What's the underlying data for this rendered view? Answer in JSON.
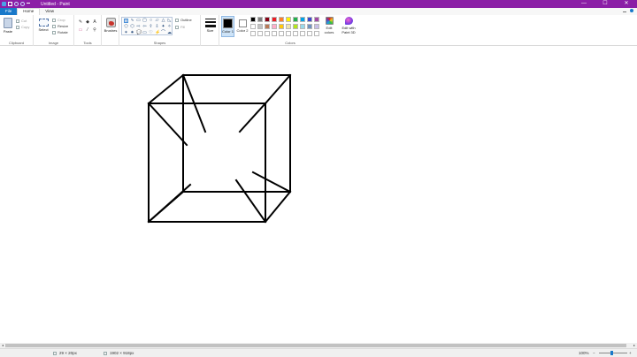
{
  "window": {
    "title": "Untitled - Paint",
    "minimize": "—",
    "maximize": "☐",
    "close": "✕"
  },
  "tabs": {
    "file": "File",
    "home": "Home",
    "view": "View"
  },
  "ribbon": {
    "clipboard": {
      "label": "Clipboard",
      "paste": "Paste",
      "cut": "Cut",
      "copy": "Copy"
    },
    "image": {
      "label": "Image",
      "select": "Select",
      "crop": "Crop",
      "resize": "Resize",
      "rotate": "Rotate"
    },
    "tools": {
      "label": "Tools",
      "pencil": "✎",
      "fill": "◆",
      "text": "A",
      "eraser": "▭",
      "picker": "⁄",
      "magnifier": "⚲"
    },
    "brushes": {
      "label": "Brushes"
    },
    "shapes": {
      "label": "Shapes",
      "outline": "Outline",
      "fill": "Fill",
      "items": [
        "\\",
        "∿",
        "▭",
        "▢",
        "○",
        "▱",
        "△",
        "◺",
        "⬠",
        "⬡",
        "⇨",
        "⇦",
        "⇧",
        "⇩",
        "✦",
        "✧",
        "✶",
        "✷",
        "💬",
        "▭",
        "♡",
        "⚡",
        "⌒",
        "☁"
      ]
    },
    "size": {
      "label": "Size"
    },
    "colors": {
      "label": "Colors",
      "color1": "Color 1",
      "color2": "Color 2",
      "color1_value": "#000000",
      "color2_value": "#ffffff",
      "edit_colors": "Edit colors",
      "edit_paint3d": "Edit with Paint 3D",
      "palette": [
        "#000000",
        "#7f7f7f",
        "#880015",
        "#ed1c24",
        "#ff7f27",
        "#fff200",
        "#22b14c",
        "#00a2e8",
        "#3f48cc",
        "#a349a4",
        "#ffffff",
        "#c3c3c3",
        "#b97a57",
        "#ffaec9",
        "#ffc90e",
        "#efe4b0",
        "#b5e61d",
        "#99d9ea",
        "#7092be",
        "#c8bfe7",
        "#ffffff",
        "#ffffff",
        "#ffffff",
        "#ffffff",
        "#ffffff",
        "#ffffff",
        "#ffffff",
        "#ffffff",
        "#ffffff",
        "#ffffff"
      ]
    }
  },
  "status": {
    "cursor": "29 × 20px",
    "image_size": "1902 × 918px",
    "zoom": "100%",
    "zoom_minus": "−",
    "zoom_plus": "+"
  }
}
